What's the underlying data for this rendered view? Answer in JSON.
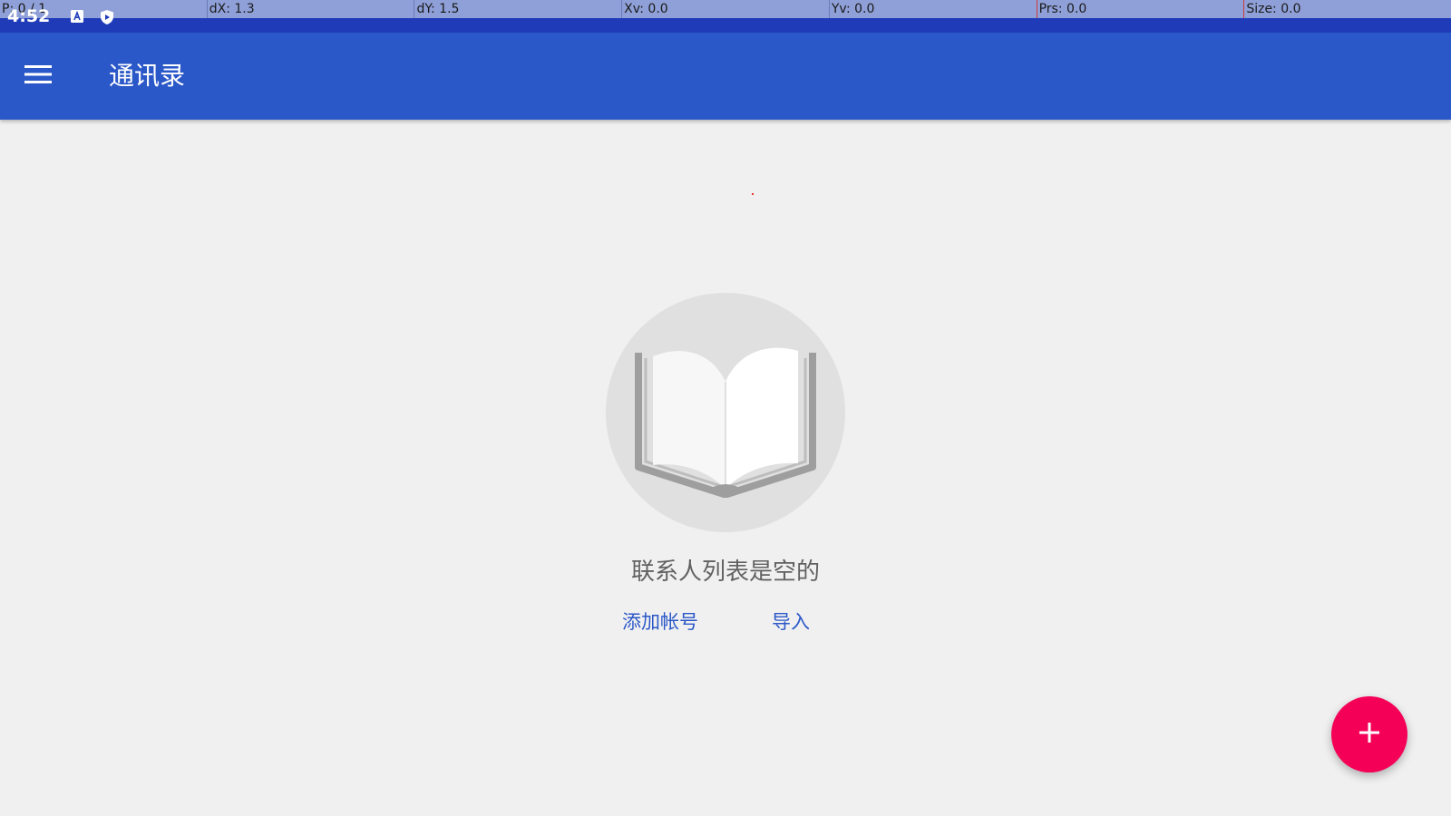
{
  "debug_overlay": {
    "cells": [
      "P: 0 / 1",
      "dX: 1.3",
      "dY: 1.5",
      "Xv: 0.0",
      "Yv: 0.0",
      "Prs: 0.0",
      "Size: 0.0"
    ]
  },
  "status_bar": {
    "time": "4:52",
    "icons": [
      "keyboard-a-icon",
      "play-protect-icon"
    ]
  },
  "app_bar": {
    "menu_icon": "hamburger-menu-icon",
    "title": "通讯录"
  },
  "empty_state": {
    "illustration_icon": "open-book-icon",
    "message": "联系人列表是空的",
    "add_account_label": "添加帐号",
    "import_label": "导入"
  },
  "fab": {
    "icon": "plus-icon"
  },
  "colors": {
    "status_bar": "#1f3bb8",
    "app_bar": "#2b58c8",
    "background": "#f0f0f0",
    "accent": "#f50057",
    "link": "#2b58c8",
    "debug_bar": "#8fa0d8"
  }
}
